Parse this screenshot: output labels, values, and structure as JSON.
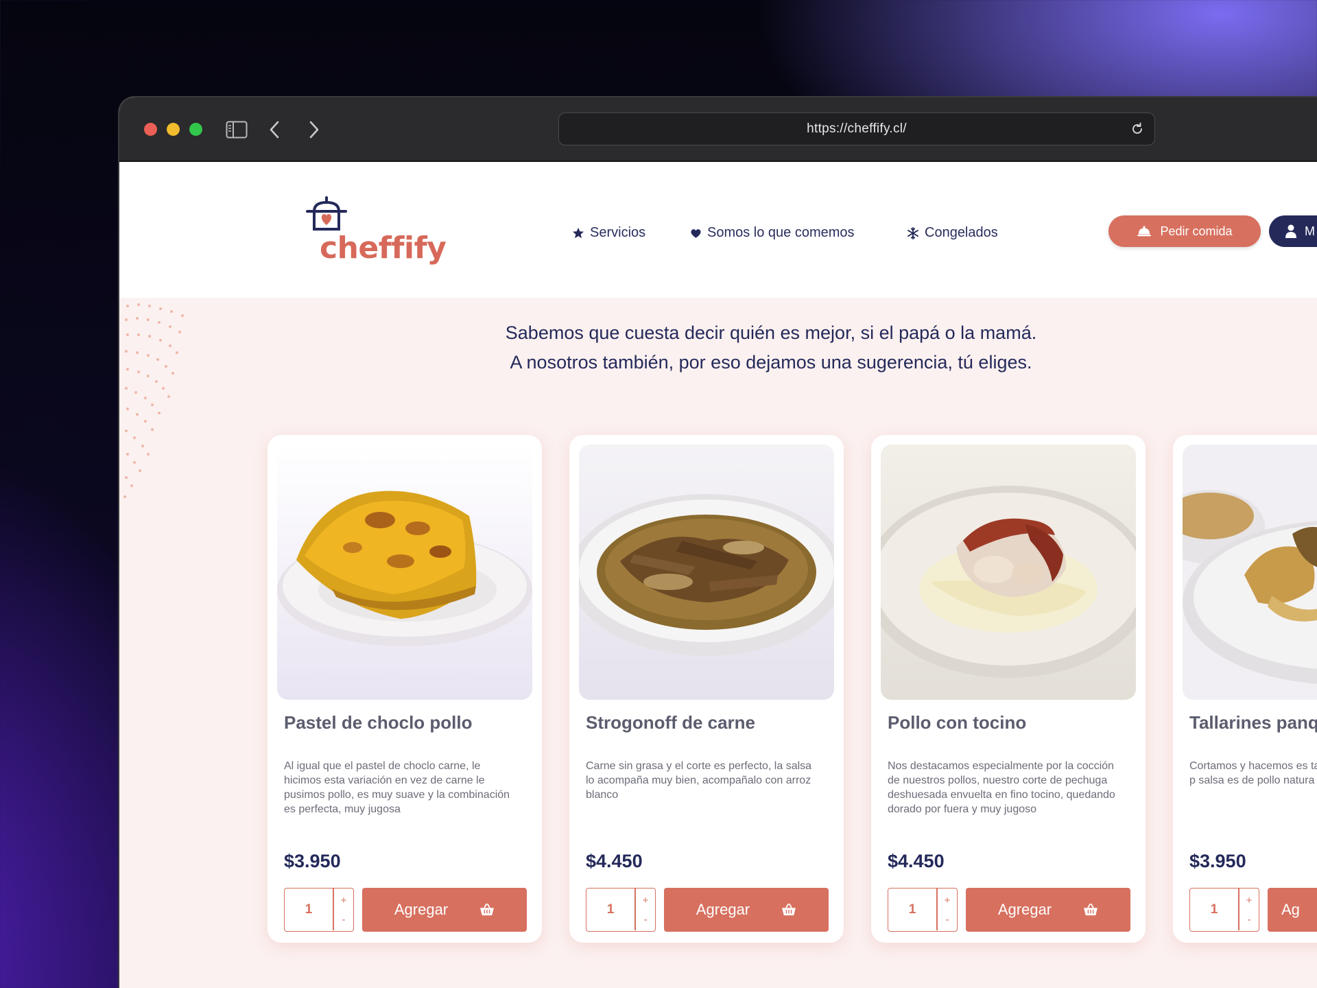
{
  "browser": {
    "url": "https://cheffify.cl/"
  },
  "header": {
    "logo_text": "cheffify",
    "nav": [
      {
        "label": "Servicios",
        "icon": "star-icon"
      },
      {
        "label": "Somos lo que comemos",
        "icon": "heart-icon"
      },
      {
        "label": "Congelados",
        "icon": "snowflake-icon"
      }
    ],
    "order_button": "Pedir comida",
    "account_button": "M"
  },
  "tagline": {
    "line1": "Sabemos que cuesta decir quién es mejor, si el papá o la mamá.",
    "line2": "A nosotros también, por eso dejamos una sugerencia, tú eliges."
  },
  "products": [
    {
      "title": "Pastel de choclo pollo",
      "description": "Al igual que el pastel de choclo carne, le hicimos esta variación en vez de carne le pusimos pollo, es muy suave y la combinación es perfecta, muy jugosa",
      "price": "$3.950",
      "qty": "1",
      "add_label": "Agregar"
    },
    {
      "title": "Strogonoff de carne",
      "description": "Carne sin grasa y el corte es perfecto, la salsa lo acompaña muy bien, acompañalo con arroz blanco",
      "price": "$4.450",
      "qty": "1",
      "add_label": "Agregar"
    },
    {
      "title": "Pollo con tocino",
      "description": "Nos destacamos especialmente por la cocción de nuestros pollos, nuestro corte de pechuga deshuesada envuelta en fino tocino, quedando dorado por fuera y muy jugoso",
      "price": "$4.450",
      "qty": "1",
      "add_label": "Agregar"
    },
    {
      "title": "Tallarines panq salsa pollo",
      "description": "Cortamos y hacemos es tallarines con nuestros p salsa es de pollo natura",
      "price": "$3.950",
      "qty": "1",
      "add_label": "Ag"
    }
  ],
  "qty_controls": {
    "plus": "+",
    "minus": "-"
  },
  "colors": {
    "accent": "#d7705f",
    "navy": "#24295a",
    "page_bg": "#fbf1f0"
  }
}
